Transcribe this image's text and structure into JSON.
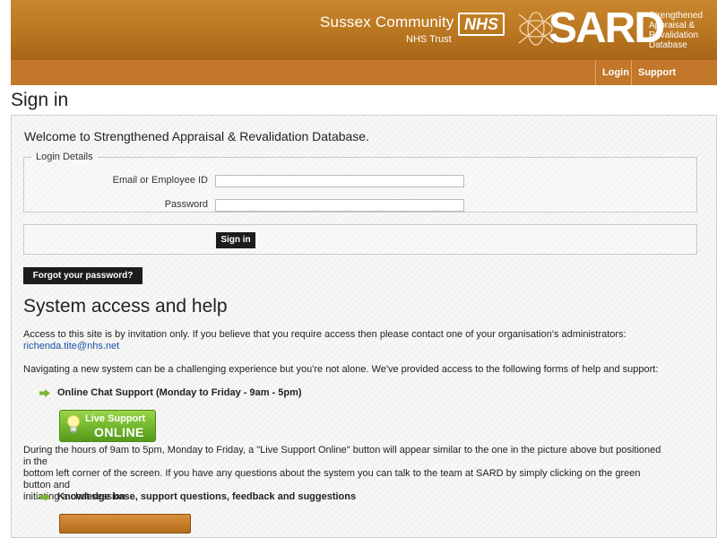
{
  "header": {
    "org_name": "Sussex Community",
    "org_sub": "NHS Trust",
    "nhs_logo": "NHS",
    "product_logo": "SARD",
    "product_desc_1": "Strengthened",
    "product_desc_2": "Appraisal &",
    "product_desc_3": "Revalidation",
    "product_desc_4": "Database"
  },
  "nav": {
    "login": "Login",
    "support_videos": "Support Videos"
  },
  "page": {
    "title": "Sign in",
    "welcome": "Welcome to Strengthened Appraisal & Revalidation Database."
  },
  "login_form": {
    "legend": "Login Details",
    "email_label": "Email or Employee ID",
    "email_value": "",
    "password_label": "Password",
    "password_value": "",
    "signin_button": "Sign in",
    "forgot_button": "Forgot your password?"
  },
  "help": {
    "title": "System access and help",
    "access_text": "Access to this site is by invitation only. If you believe that you require access then please contact one of your organisation's administrators:",
    "admin_email": "richenda.tite@nhs.net",
    "intro_text": "Navigating a new system can be a challenging experience but you're not alone. We've provided access to the following forms of help and support:",
    "chat_heading": "Online Chat Support (Monday to Friday - 9am - 5pm)",
    "live_support_line1": "Live Support",
    "live_support_line2": "ONLINE",
    "chat_desc_1": "During the hours of 9am to 5pm, Monday to Friday, a \"Live Support Online\" button will appear similar to the one in the picture above but positioned in the",
    "chat_desc_2": "bottom left corner of the screen. If you have any questions about the system you can talk to the team at SARD by simply clicking on the green button and",
    "chat_desc_3": "initiating a chat session.",
    "kb_heading": "Knowledge base, support questions, feedback and suggestions"
  },
  "colors": {
    "banner": "#bd7a22",
    "nav": "#c2772a",
    "button_dark": "#1c1c1c",
    "live_green": "#6fb62b",
    "link": "#1a4fa8"
  }
}
